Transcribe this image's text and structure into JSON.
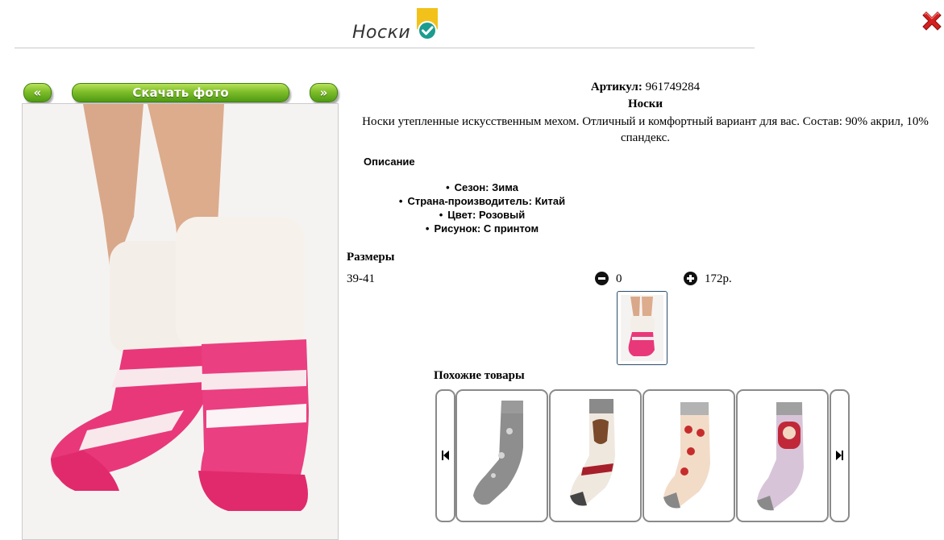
{
  "header": {
    "title": "Носки",
    "verified_icon": "verified-check-badge",
    "close_icon": "red-x-close"
  },
  "gallery": {
    "prev_label": "«",
    "download_label": "Скачать фото",
    "next_label": "»"
  },
  "product": {
    "article_label": "Артикул:",
    "article_value": "961749284",
    "name": "Носки",
    "description": "Носки утепленные искусственным мехом. Отличный и комфортный вариант для вас. Состав: 90% акрил, 10% спандекс.",
    "description_heading": "Описание",
    "attributes": [
      "Сезон: Зима",
      "Страна-производитель: Китай",
      "Цвет: Розовый",
      "Рисунок: С принтом"
    ]
  },
  "sizes": {
    "heading": "Размеры",
    "rows": [
      {
        "size": "39-41",
        "quantity": "0",
        "price": "172р."
      }
    ]
  },
  "similar": {
    "heading": "Похожие товары",
    "items": [
      "grey-snowflake-socks",
      "deer-print-socks",
      "red-pattern-socks",
      "matryoshka-socks"
    ]
  },
  "colors": {
    "accent_green": "#7fbe2a",
    "close_red": "#d42020",
    "badge_teal": "#1a9c8f",
    "badge_gold": "#f2c21b",
    "sock_pink": "#e8387a"
  }
}
